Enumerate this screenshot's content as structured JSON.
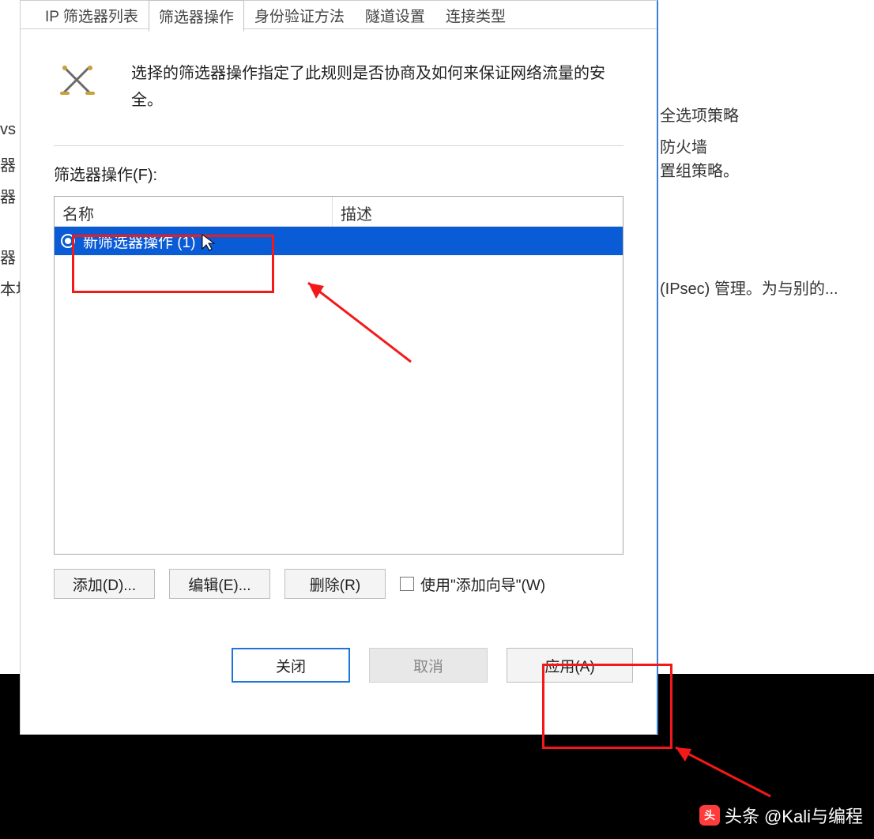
{
  "tabs": {
    "ip_filter_list": "IP 筛选器列表",
    "filter_action": "筛选器操作",
    "auth_method": "身份验证方法",
    "tunnel_settings": "隧道设置",
    "connection_type": "连接类型"
  },
  "intro_text": "选择的筛选器操作指定了此规则是否协商及如何来保证网络流量的安全。",
  "list_label": "筛选器操作(F):",
  "columns": {
    "name": "名称",
    "desc": "描述"
  },
  "row": {
    "name": "新筛选器操作 (1)",
    "desc": ""
  },
  "buttons": {
    "add": "添加(D)...",
    "edit": "编辑(E)...",
    "delete": "删除(R)",
    "wizard": "使用\"添加向导\"(W)",
    "close": "关闭",
    "cancel": "取消",
    "apply": "应用(A)"
  },
  "bg_fragments": {
    "f1": "vs",
    "f2": "器",
    "f3": "器",
    "f4": "器",
    "f5": "本地",
    "r1": "全选项策略",
    "r2": "防火墙",
    "r3": "置组策略。",
    "r4": "(IPsec) 管理。为与别的..."
  },
  "watermark": {
    "brand": "头条",
    "handle": "@Kali与编程"
  }
}
